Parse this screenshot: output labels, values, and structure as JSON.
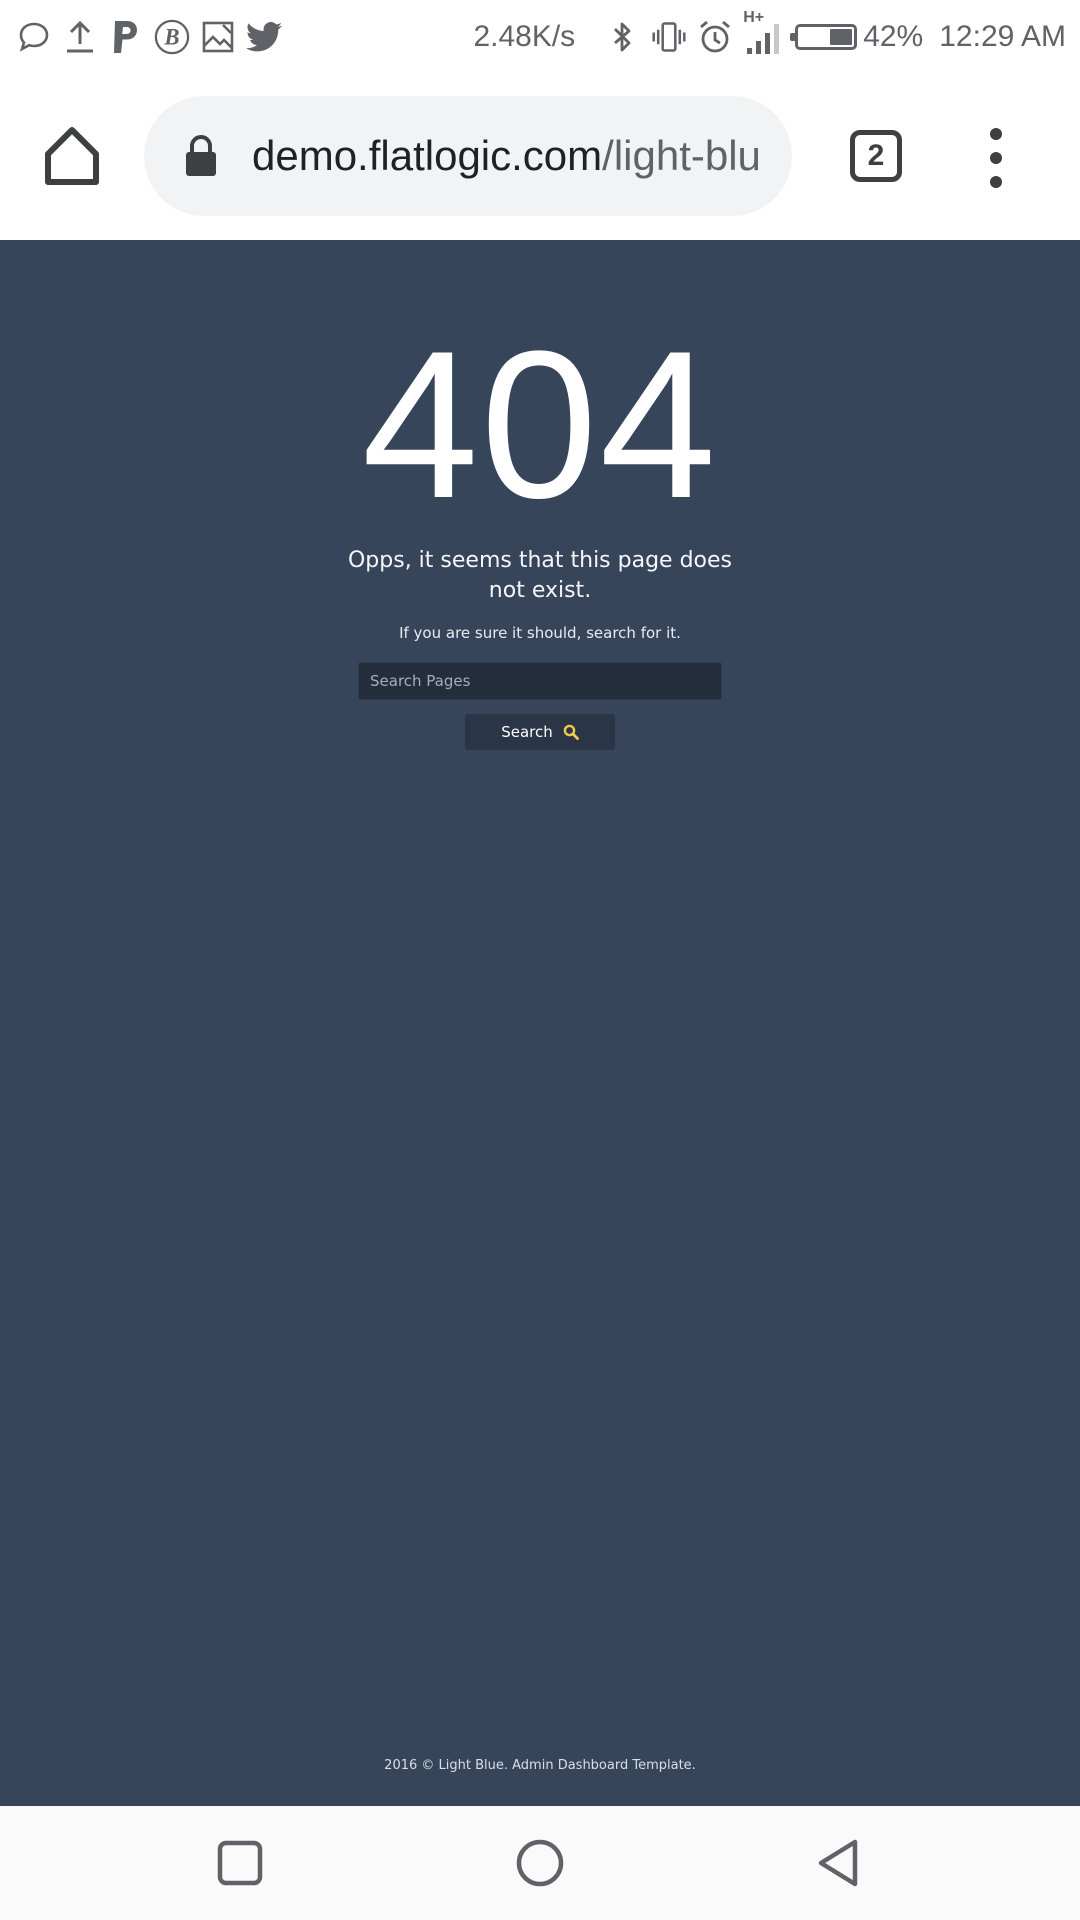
{
  "status_bar": {
    "net_speed": "2.48K/s",
    "network_type": "H+",
    "battery_percent": "42%",
    "battery_level": 0.42,
    "time": "12:29 AM",
    "left_icons": [
      "chat-bubble-icon",
      "upload-icon",
      "paypal-icon",
      "bitcoin-icon",
      "image-icon",
      "twitter-icon"
    ],
    "right_icons": [
      "bluetooth-icon",
      "vibrate-icon",
      "alarm-icon",
      "signal-icon",
      "battery-icon"
    ]
  },
  "browser": {
    "url_domain": "demo.flatlogic.com",
    "url_path": "/light-blu",
    "tab_count": "2"
  },
  "page": {
    "error_code": "404",
    "message": "Opps, it seems that this page does not exist.",
    "hint": "If you are sure it should, search for it.",
    "search_placeholder": "Search Pages",
    "search_button": "Search",
    "footer": "2016 © Light Blue. Admin Dashboard Template."
  },
  "colors": {
    "page_background": "#37455b",
    "search_icon": "#f0c94a"
  }
}
